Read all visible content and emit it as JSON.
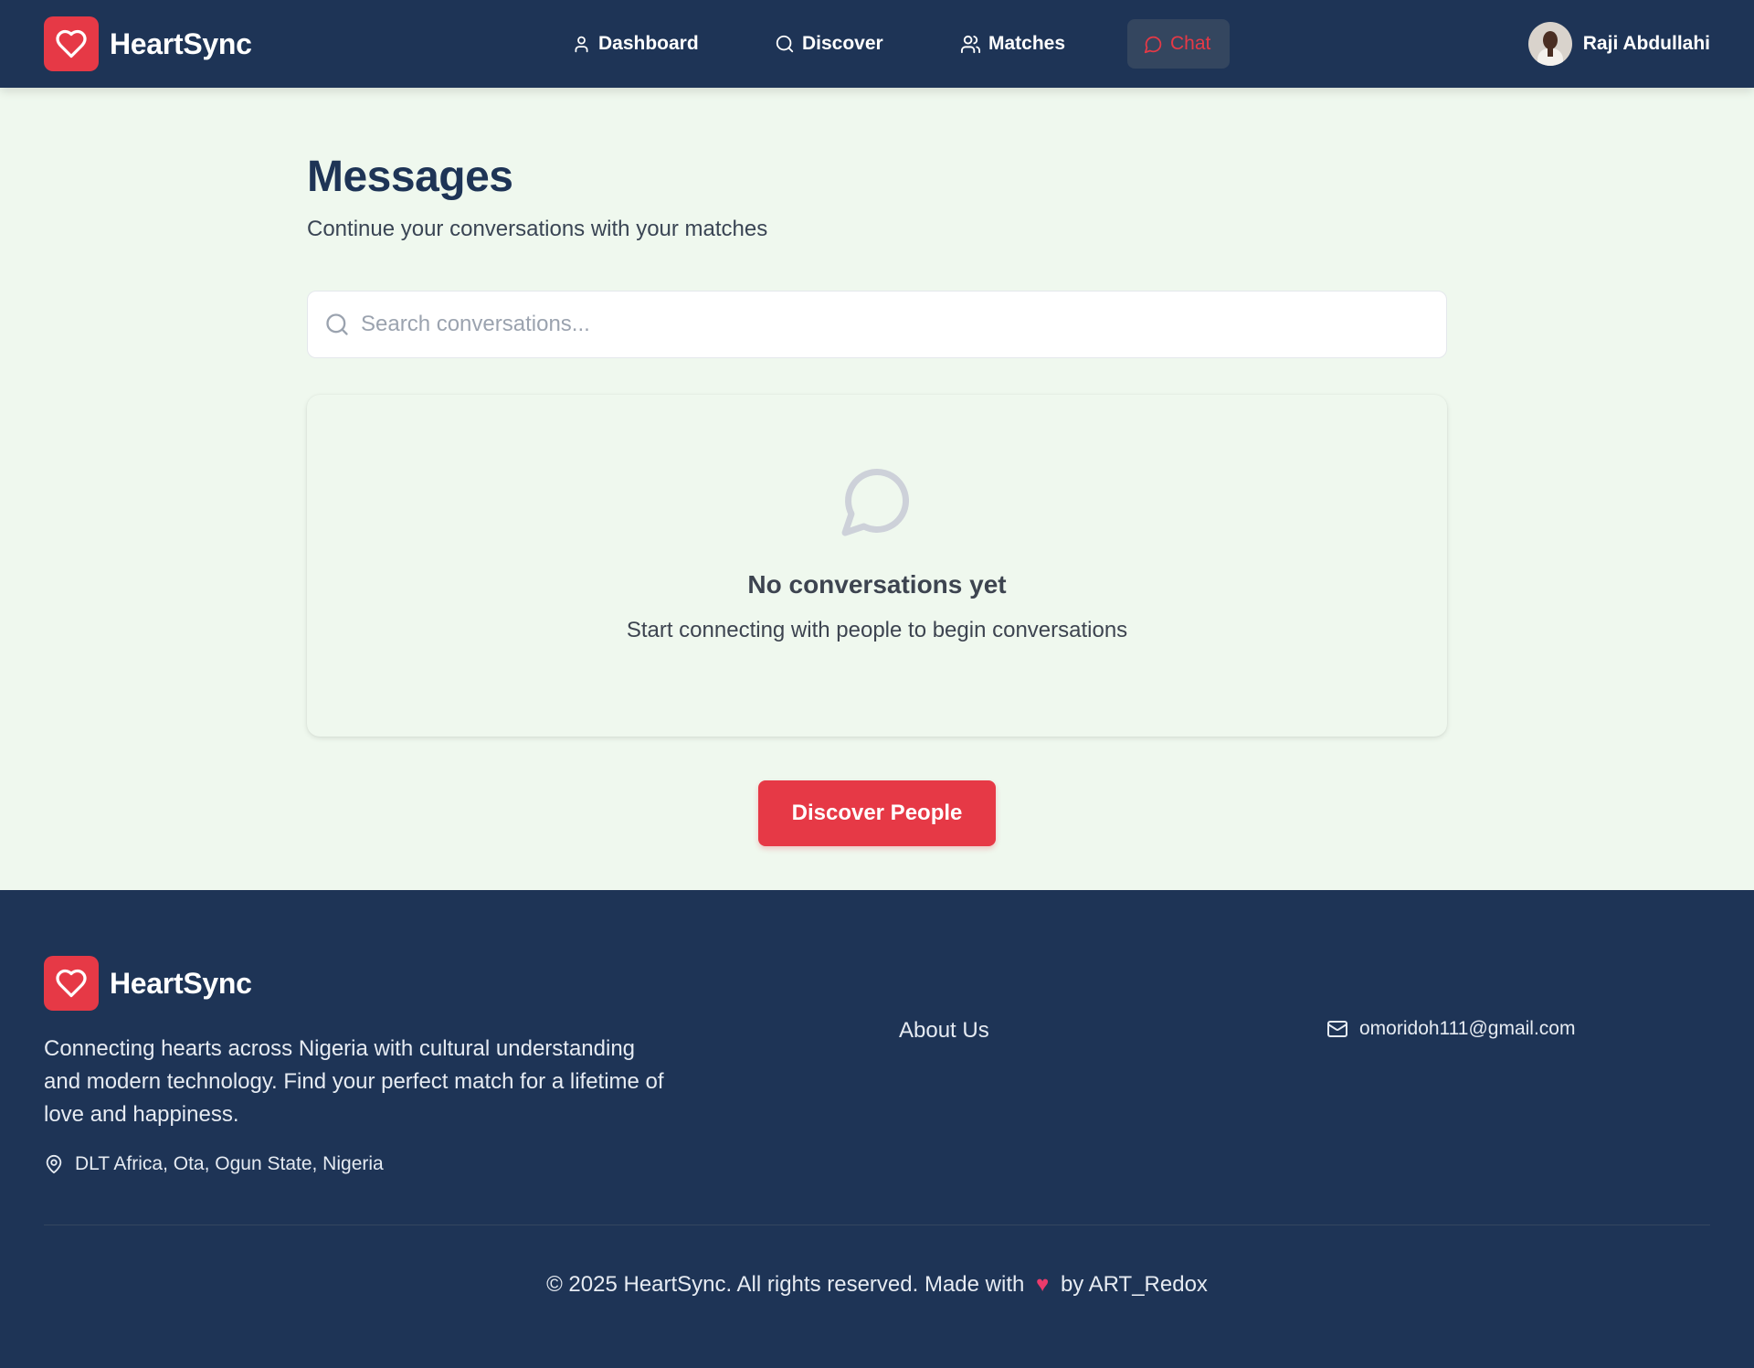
{
  "brand": {
    "name": "HeartSync",
    "accent": "#e63946",
    "navy": "#1e3456",
    "background": "#eff8ee"
  },
  "nav": {
    "items": [
      {
        "label": "Dashboard",
        "icon": "user-icon",
        "active": false
      },
      {
        "label": "Discover",
        "icon": "search-icon",
        "active": false
      },
      {
        "label": "Matches",
        "icon": "users-icon",
        "active": false
      },
      {
        "label": "Chat",
        "icon": "message-circle-icon",
        "active": true
      }
    ]
  },
  "user": {
    "name": "Raji Abdullahi"
  },
  "main": {
    "title": "Messages",
    "subtitle": "Continue your conversations with your matches",
    "search": {
      "placeholder": "Search conversations...",
      "value": ""
    },
    "empty": {
      "icon": "message-circle-icon",
      "title": "No conversations yet",
      "text": "Start connecting with people to begin conversations"
    },
    "cta_label": "Discover People"
  },
  "footer": {
    "brand_name": "HeartSync",
    "description": "Connecting hearts across Nigeria with cultural understanding and modern technology. Find your perfect match for a lifetime of love and happiness.",
    "location": "DLT Africa, Ota, Ogun State, Nigeria",
    "about_link": "About Us",
    "email": "omoridoh111@gmail.com",
    "copyright_before": "© 2025 HeartSync. All rights reserved. Made with",
    "heart": "♥",
    "copyright_after": "by ART_Redox"
  }
}
